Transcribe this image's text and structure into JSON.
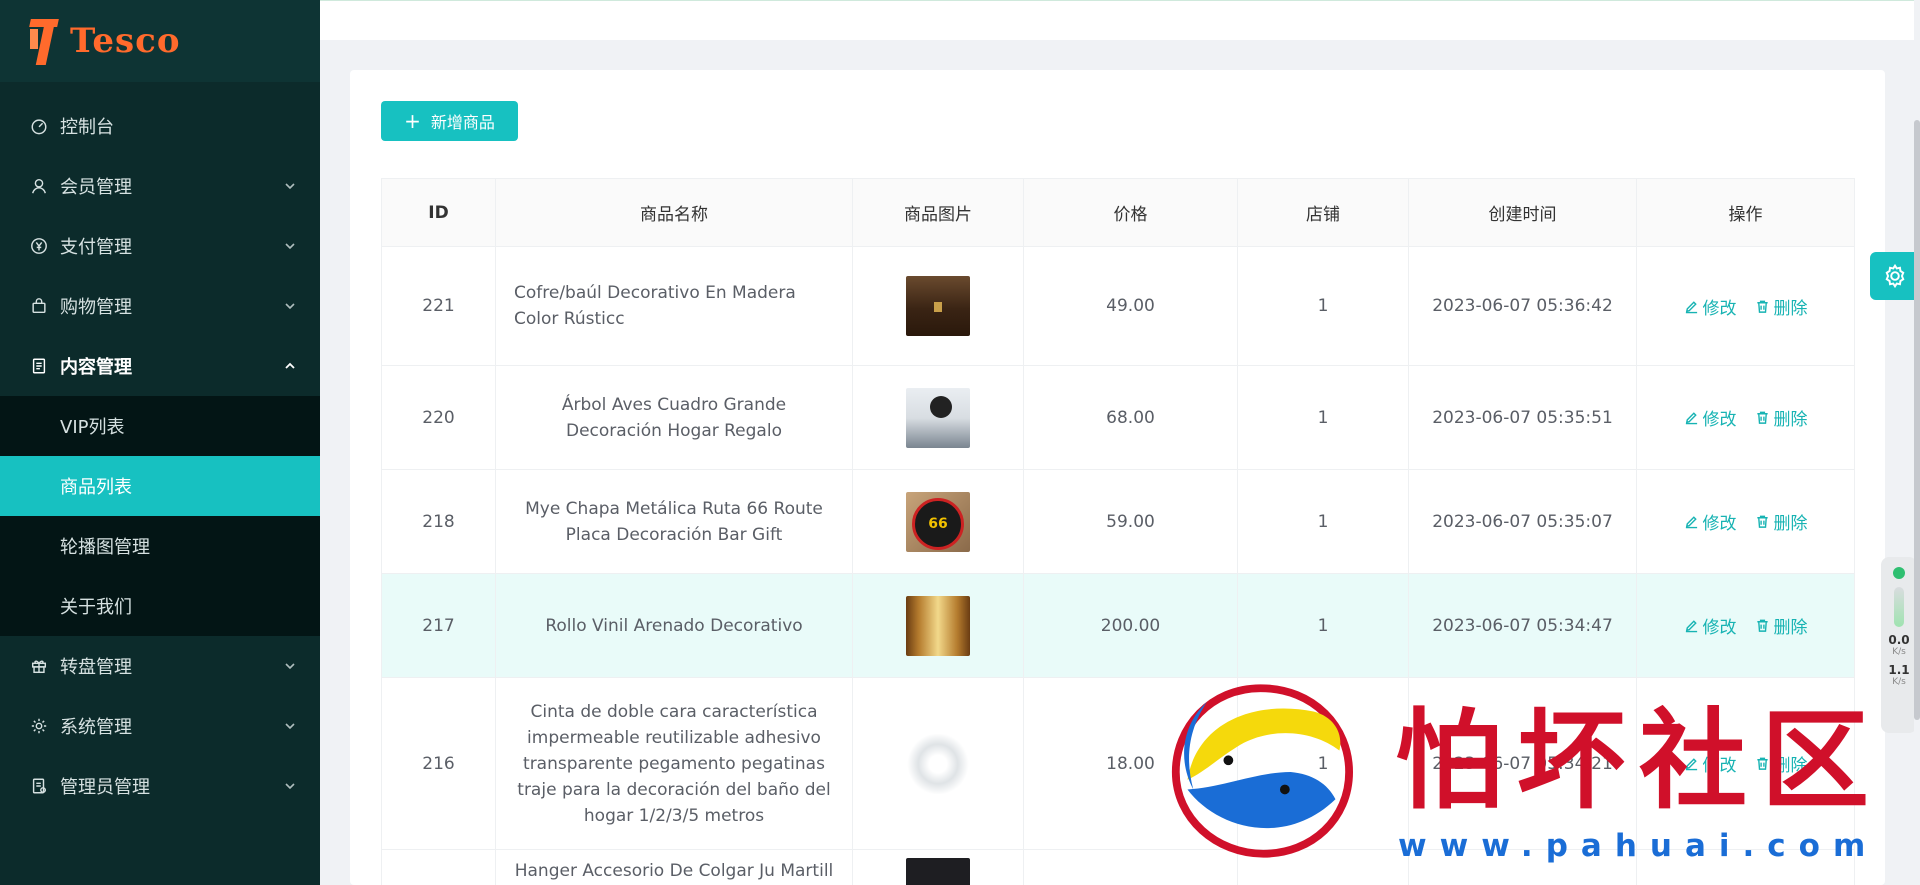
{
  "brand": {
    "name": "Tesco"
  },
  "sidebar": {
    "items": [
      {
        "label": "控制台",
        "icon": "dashboard-icon",
        "has_children": false
      },
      {
        "label": "会员管理",
        "icon": "user-icon",
        "has_children": true
      },
      {
        "label": "支付管理",
        "icon": "yen-icon",
        "has_children": true
      },
      {
        "label": "购物管理",
        "icon": "bag-icon",
        "has_children": true
      },
      {
        "label": "内容管理",
        "icon": "document-icon",
        "has_children": true,
        "open": true
      },
      {
        "label": "转盘管理",
        "icon": "gift-icon",
        "has_children": true
      },
      {
        "label": "系统管理",
        "icon": "gear-icon",
        "has_children": true
      },
      {
        "label": "管理员管理",
        "icon": "admin-icon",
        "has_children": true
      }
    ],
    "content_submenu": [
      {
        "label": "VIP列表"
      },
      {
        "label": "商品列表",
        "active": true
      },
      {
        "label": "轮播图管理"
      },
      {
        "label": "关于我们"
      }
    ]
  },
  "toolbar": {
    "add_label": "新增商品"
  },
  "table": {
    "columns": [
      "ID",
      "商品名称",
      "商品图片",
      "价格",
      "店铺",
      "创建时间",
      "操作"
    ],
    "edit_label": "修改",
    "delete_label": "删除",
    "rows": [
      {
        "id": "221",
        "name": "Cofre/baúl Decorativo En Madera Color Rústicc",
        "price": "49.00",
        "shop": "1",
        "created": "2023-06-07 05:36:42",
        "image": "wooden-chest-image"
      },
      {
        "id": "220",
        "name": "Árbol Aves Cuadro Grande Decoración Hogar Regalo",
        "price": "68.00",
        "shop": "1",
        "created": "2023-06-07 05:35:51",
        "image": "bird-tree-art-image"
      },
      {
        "id": "218",
        "name": "Mye Chapa Metálica Ruta 66 Route Placa Decoración Bar Gift",
        "price": "59.00",
        "shop": "1",
        "created": "2023-06-07 05:35:07",
        "image": "route-66-sign-image"
      },
      {
        "id": "217",
        "name": "Rollo Vinil Arenado Decorativo",
        "price": "200.00",
        "shop": "1",
        "created": "2023-06-07 05:34:47",
        "image": "vinyl-door-image"
      },
      {
        "id": "216",
        "name": "Cinta de doble cara característica impermeable reutilizable adhesivo transparente pegamento pegatinas traje para la decoración del baño del hogar 1/2/3/5 metros",
        "price": "18.00",
        "shop": "1",
        "created": "2023-06-07 05:34:21",
        "image": "clear-tape-image"
      },
      {
        "id": "",
        "name": "Hanger Accesorio De Colgar Ju Martill",
        "price": "",
        "shop": "",
        "created": "",
        "image": "dark-product-image"
      }
    ]
  },
  "net_widget": {
    "down": "0.0",
    "up": "1.1",
    "unit": "K/s"
  },
  "watermark": {
    "text": "怕坏社区",
    "url": "www.pahuai.com"
  },
  "colors": {
    "accent": "#17c1c1",
    "sidebar_bg": "#0c2b2b",
    "brand_orange": "#ff6a2c",
    "watermark_red": "#d0102a",
    "watermark_blue": "#1a6dd6"
  }
}
